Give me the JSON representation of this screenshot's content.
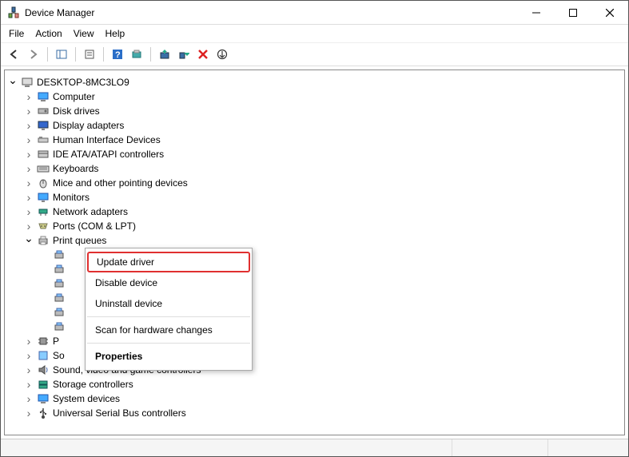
{
  "title": "Device Manager",
  "menus": {
    "file": "File",
    "action": "Action",
    "view": "View",
    "help": "Help"
  },
  "root_label": "DESKTOP-8MC3LO9",
  "categories": {
    "computer": "Computer",
    "disk_drives": "Disk drives",
    "display_adapters": "Display adapters",
    "hid": "Human Interface Devices",
    "ide": "IDE ATA/ATAPI controllers",
    "keyboards": "Keyboards",
    "mice": "Mice and other pointing devices",
    "monitors": "Monitors",
    "network": "Network adapters",
    "ports": "Ports (COM & LPT)",
    "print_queues": "Print queues",
    "processors_partial": "P",
    "softdev_partial": "So",
    "sound": "Sound, video and game controllers",
    "storage": "Storage controllers",
    "system": "System devices",
    "usb": "Universal Serial Bus controllers"
  },
  "context_menu": {
    "update_driver": "Update driver",
    "disable_device": "Disable device",
    "uninstall_device": "Uninstall device",
    "scan_hw": "Scan for hardware changes",
    "properties": "Properties"
  }
}
